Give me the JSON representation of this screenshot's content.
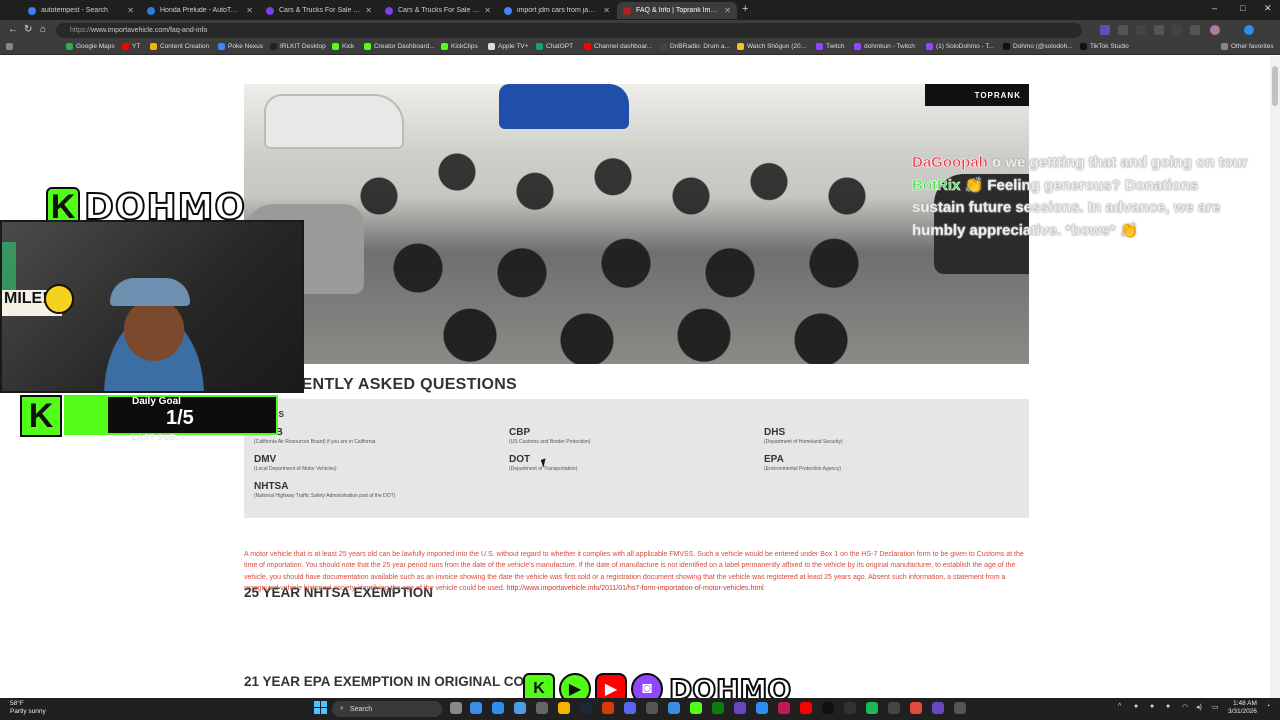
{
  "browser": {
    "tabs": [
      {
        "label": "autotempest - Search",
        "color": "#3b82f6"
      },
      {
        "label": "Honda Prelude - AutoTempest.com",
        "color": "#2a7de1"
      },
      {
        "label": "Cars & Trucks For Sale \"Honda\" near",
        "color": "#7b3fe4"
      },
      {
        "label": "Cars & Trucks For Sale \"Honda\" near",
        "color": "#7b3fe4"
      },
      {
        "label": "import jdm cars from japan - Goog",
        "color": "#4285f4"
      },
      {
        "label": "FAQ & Info | Toprank Importers",
        "color": "#b22222"
      }
    ],
    "window_controls": [
      "–",
      "□",
      "✕"
    ],
    "url_scheme": "https://",
    "url_rest": "www.importavehicle.com/faq-and-info",
    "bookmarks": [
      {
        "label": "Google Maps",
        "color": "#34a853"
      },
      {
        "label": "YT",
        "color": "#ff0000"
      },
      {
        "label": "Content Creation",
        "color": "#f4b400"
      },
      {
        "label": "Poke Nexus",
        "color": "#4285f4"
      },
      {
        "label": "IRLKIT Desktop",
        "color": "#222222"
      },
      {
        "label": "Kick",
        "color": "#53fc18"
      },
      {
        "label": "Creator Dashboard...",
        "color": "#53fc18"
      },
      {
        "label": "KickClips",
        "color": "#53fc18"
      },
      {
        "label": "Apple TV+",
        "color": "#dddddd"
      },
      {
        "label": "ChatGPT",
        "color": "#10a37f"
      },
      {
        "label": "Channel dashboar...",
        "color": "#ff0000"
      },
      {
        "label": "DnBRadio: Drum a...",
        "color": "#444444"
      },
      {
        "label": "Watch Shōgun (20...",
        "color": "#f5c518"
      },
      {
        "label": "Twitch",
        "color": "#9146ff"
      },
      {
        "label": "dohmkun - Twitch",
        "color": "#9146ff"
      },
      {
        "label": "(1) SoloDohmo - T...",
        "color": "#9146ff"
      },
      {
        "label": "Dohmo (@solodoh...",
        "color": "#111111"
      },
      {
        "label": "TikTok Studio",
        "color": "#111111"
      }
    ],
    "other_favorites": "Other favorites"
  },
  "page": {
    "hero_badge": "TOPRANK",
    "faq_title": "FREQUENTLY ASKED QUESTIONS",
    "terms_heading": "TERMS",
    "terms": [
      {
        "abbr": "CARB",
        "desc": "(California Air Resources Board) if you are in California"
      },
      {
        "abbr": "CBP",
        "desc": "(US Customs and Border Protection)"
      },
      {
        "abbr": "DHS",
        "desc": "(Department of Homeland Security)"
      },
      {
        "abbr": "DMV",
        "desc": "(Local Department of Motor Vehicles)"
      },
      {
        "abbr": "DOT",
        "desc": "(Department of Transportation)"
      },
      {
        "abbr": "EPA",
        "desc": "(Environmental Protection Agency)"
      },
      {
        "abbr": "NHTSA",
        "desc": "(National Highway Traffic Safety Administration part of the DOT)"
      }
    ],
    "section1_title": "25 YEAR NHTSA EXEMPTION",
    "section1_text": "A motor vehicle that is at least 25 years old can be lawfully imported into the U.S. without regard to whether it complies with all applicable FMVSS. Such a vehicle would be entered under Box 1 on the HS-7 Declaration form to be given to Customs at the time of importation. You should note that the 25 year period runs from the date of the vehicle's manufacture. If the date of manufacture is not identified on a label permanently affixed to the vehicle by its original manufacturer, to establish the age of the vehicle, you should have documentation available such as an invoice showing the date the vehicle was first sold or a registration document showing that the vehicle was registered at least 25 years ago. Absent such information, a statement from a recognized vehicle historical society identifying the age of the vehicle could be used.",
    "section1_link": "http://www.importavehicle.info/2011/01/hs7-form-importation-of-motor-vehicles.html",
    "section2_title": "21 YEAR EPA EXEMPTION IN ORIGINAL CO"
  },
  "overlay": {
    "brand": "DOHMO",
    "k_glyph": "K",
    "goal_label": "Daily Goal",
    "goal_count": "1/5",
    "goal_progress": 0.2,
    "last_sub": "LAST SUB: -",
    "chat": [
      {
        "user": "DaGoopah",
        "text": "o we gettting that and going on tour"
      },
      {
        "user": "BotRix",
        "text": "👏 Feeling generous? Donations sustain future sessions. In advance, we are humbly appreciative. *bows* 👏"
      }
    ],
    "bottom_brand": "DOHMO"
  },
  "taskbar": {
    "temp": "58°F",
    "weather": "Partly sunny",
    "search": "Search",
    "time": "1:48 AM",
    "date": "3/31/2026"
  }
}
